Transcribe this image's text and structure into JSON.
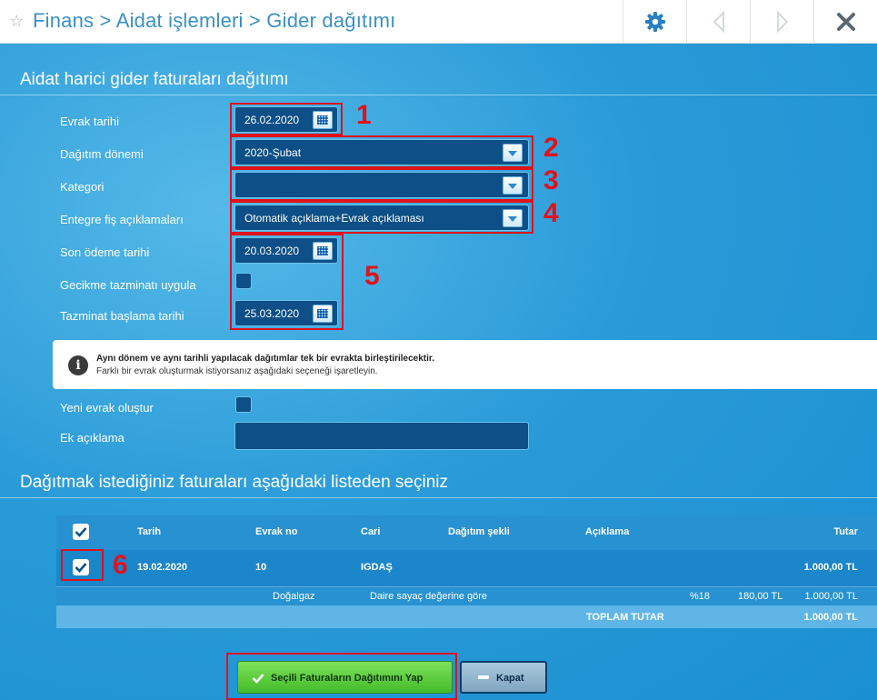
{
  "header": {
    "breadcrumb": "Finans > Aidat işlemleri > Gider dağıtımı"
  },
  "section1": {
    "title": "Aidat harici gider faturaları dağıtımı"
  },
  "form": {
    "evrak_tarihi": {
      "label": "Evrak tarihi",
      "value": "26.02.2020"
    },
    "dagitim_donemi": {
      "label": "Dağıtım dönemi",
      "value": "2020-Şubat"
    },
    "kategori": {
      "label": "Kategori",
      "value": ""
    },
    "entegre": {
      "label": "Entegre fiş açıklamaları",
      "value": "Otomatik açıklama+Evrak açıklaması"
    },
    "son_odeme": {
      "label": "Son ödeme tarihi",
      "value": "20.03.2020"
    },
    "gecikme": {
      "label": "Gecikme tazminatı uygula",
      "checked": false
    },
    "tazminat_baslama": {
      "label": "Tazminat başlama tarihi",
      "value": "25.03.2020"
    },
    "yeni_evrak": {
      "label": "Yeni evrak oluştur",
      "checked": false
    },
    "ek_aciklama": {
      "label": "Ek açıklama",
      "value": ""
    }
  },
  "info": {
    "line1": "Aynı dönem ve aynı tarihli yapılacak dağıtımlar tek bir evrakta birleştirilecektir.",
    "line2": "Farklı bir evrak oluşturmak istiyorsanız aşağıdaki seçeneği işaretleyin."
  },
  "annotations": [
    "1",
    "2",
    "3",
    "4",
    "5",
    "6"
  ],
  "section2": {
    "title": "Dağıtmak istediğiniz faturaları aşağıdaki listeden seçiniz"
  },
  "table": {
    "headers": {
      "tarih": "Tarih",
      "evrak_no": "Evrak no",
      "cari": "Cari",
      "dagitim_sekli": "Dağıtım şekli",
      "aciklama": "Açıklama",
      "tutar": "Tutar"
    },
    "row": {
      "tarih": "19.02.2020",
      "evrak_no": "10",
      "cari": "IGDAŞ",
      "tutar": "1.000,00 TL"
    },
    "detail": {
      "name": "Doğalgaz",
      "method": "Daire sayaç değerine göre",
      "rate": "%18",
      "vat": "180,00 TL",
      "amount": "1.000,00 TL"
    },
    "total": {
      "label": "TOPLAM TUTAR",
      "value": "1.000,00 TL"
    }
  },
  "buttons": {
    "distribute": "Seçili Faturaların Dağıtımını Yap",
    "close": "Kapat"
  },
  "colors": {
    "accent": "#1a8fd1",
    "field_bg": "#0d4f86",
    "annotation_red": "#e0121b",
    "primary_button": "#58c93a"
  }
}
